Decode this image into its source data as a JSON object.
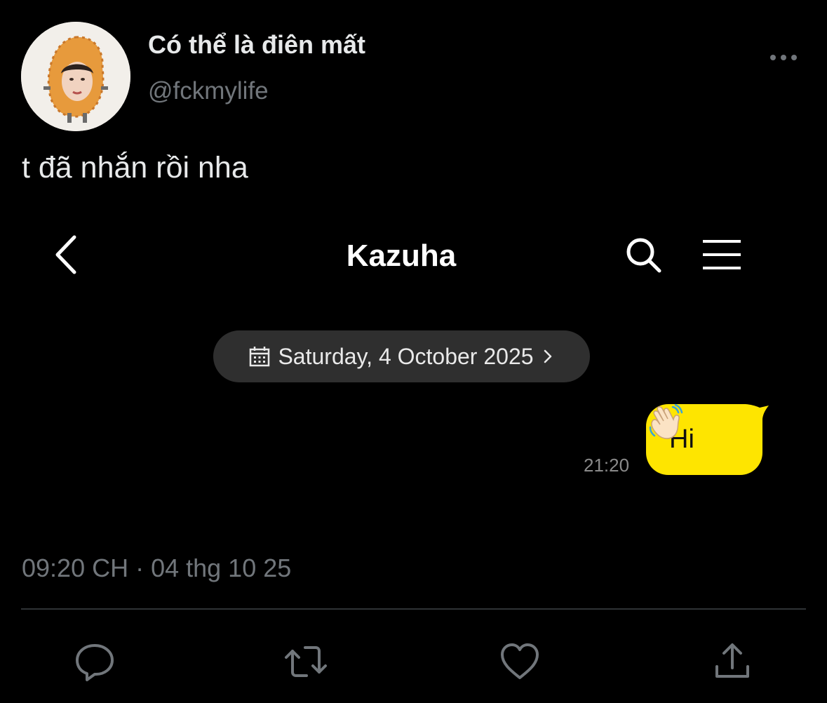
{
  "tweet": {
    "display_name": "Có thể là điên mất",
    "handle": "@fckmylife",
    "text": "t đã nhắn rồi nha",
    "timestamp": "09:20 CH · 04 thg 10 25"
  },
  "icons": {
    "more": "more-horizontal-icon",
    "reply": "reply-icon",
    "retweet": "retweet-icon",
    "like": "heart-icon",
    "share": "share-icon"
  },
  "chat": {
    "title": "Kazuha",
    "date_pill": "Saturday, 4 October 2025",
    "message": {
      "text": "Hi",
      "emoji": "waving-hand",
      "time": "21:20"
    }
  },
  "colors": {
    "background": "#000000",
    "primary_text": "#e7e9ea",
    "secondary_text": "#71767b",
    "bubble": "#fee500",
    "date_pill": "#2f2f2f"
  }
}
